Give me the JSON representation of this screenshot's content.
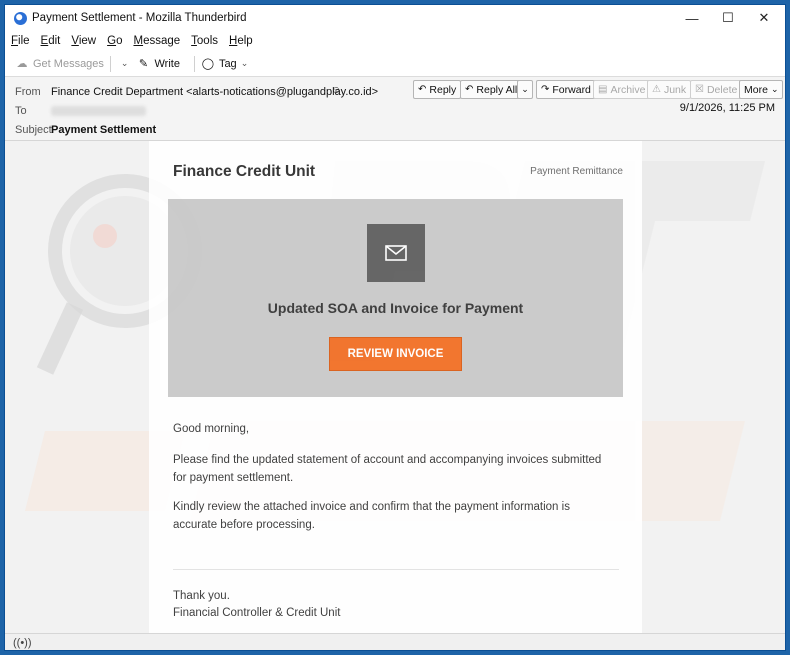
{
  "window": {
    "title": "Payment Settlement - Mozilla Thunderbird"
  },
  "menu": [
    "File",
    "Edit",
    "View",
    "Go",
    "Message",
    "Tools",
    "Help"
  ],
  "toolbar": {
    "get_messages": "Get Messages",
    "write": "Write",
    "tag": "Tag"
  },
  "header": {
    "from_label": "From",
    "from_value": "Finance Credit Department <alarts-notications@plugandplay.co.id>",
    "to_label": "To",
    "subject_label": "Subject",
    "subject_value": "Payment Settlement",
    "date": "9/1/2026, 11:25 PM",
    "buttons": {
      "reply": "Reply",
      "reply_all": "Reply All",
      "forward": "Forward",
      "archive": "Archive",
      "junk": "Junk",
      "delete": "Delete",
      "more": "More"
    }
  },
  "email": {
    "brand": "Finance Credit Unit",
    "remittance": "Payment Remittance",
    "hero_title": "Updated SOA and Invoice for Payment",
    "cta": "REVIEW INVOICE",
    "greeting": "Good morning,",
    "para1": "Please find the updated statement of account and accompanying invoices submitted for payment settlement.",
    "para2": "Kindly review the attached invoice and confirm that the payment information is accurate before processing.",
    "signoff": "Thank you.",
    "signature": "Financial Controller & Credit Unit"
  },
  "colors": {
    "accent": "#f26d21",
    "hero_bg": "#c9c9c9",
    "window_border": "#1e64a8"
  }
}
